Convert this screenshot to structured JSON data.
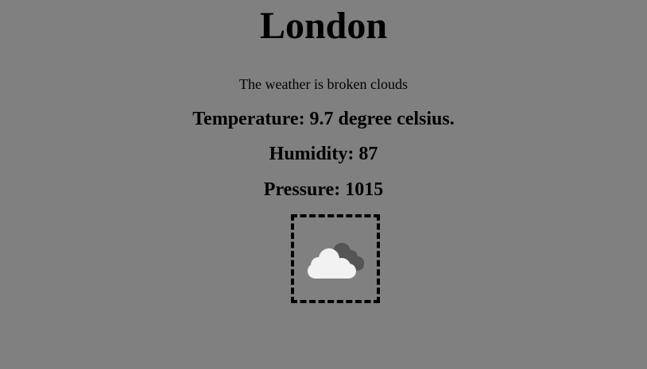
{
  "city": "London",
  "weather_description": "The weather is broken clouds",
  "temperature_text": "Temperature: 9.7 degree celsius.",
  "humidity_text": "Humidity: 87",
  "pressure_text": "Pressure: 1015",
  "weather_icon": "broken-clouds-icon",
  "colors": {
    "background": "#808080",
    "cloud_front": "#f2f2f2",
    "cloud_back": "#555555",
    "border": "#000000"
  }
}
